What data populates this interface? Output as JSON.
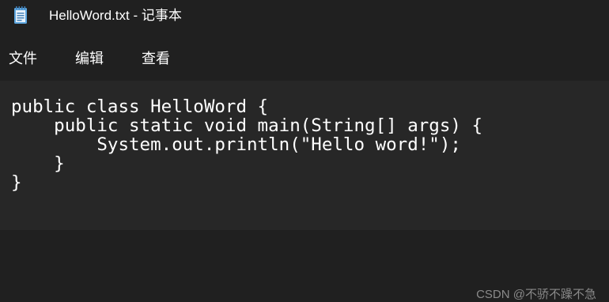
{
  "window": {
    "title": "HelloWord.txt - 记事本",
    "icon": "notepad-icon"
  },
  "menu": {
    "items": [
      {
        "label": "文件"
      },
      {
        "label": "编辑"
      },
      {
        "label": "查看"
      }
    ]
  },
  "editor": {
    "lines": [
      "public class HelloWord {",
      "    public static void main(String[] args) {",
      "        System.out.println(\"Hello word!\");",
      "    }",
      "}"
    ]
  },
  "watermark": {
    "text": "CSDN @不骄不躁不急"
  },
  "colors": {
    "background": "#202020",
    "editor_background": "#272727",
    "text": "#ffffff",
    "icon_accent": "#5ea7e0"
  }
}
